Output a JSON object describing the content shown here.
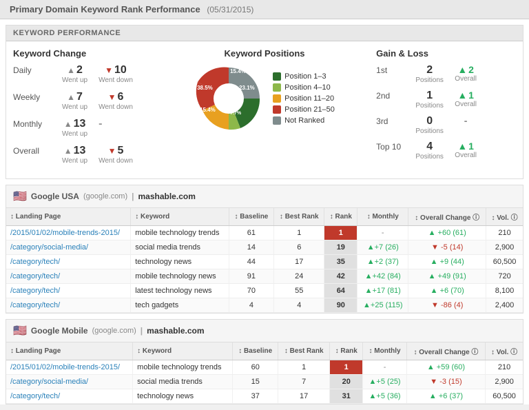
{
  "header": {
    "title": "Primary Domain Keyword Rank Performance",
    "date": "(05/31/2015)"
  },
  "keyword_performance": {
    "section_label": "KEYWORD PERFORMANCE",
    "keyword_change": {
      "title": "Keyword Change",
      "rows": [
        {
          "label": "Daily",
          "up": "2",
          "up_sub": "Went up",
          "down": "10",
          "down_sub": "Went down",
          "has_down": true
        },
        {
          "label": "Weekly",
          "up": "7",
          "up_sub": "Went up",
          "down": "6",
          "down_sub": "Went down",
          "has_down": true
        },
        {
          "label": "Monthly",
          "up": "13",
          "up_sub": "Went up",
          "down": "-",
          "down_sub": "",
          "has_down": false
        },
        {
          "label": "Overall",
          "up": "13",
          "up_sub": "Went up",
          "down": "5",
          "down_sub": "Went down",
          "has_down": true
        }
      ]
    },
    "keyword_positions": {
      "title": "Keyword Positions",
      "chart": {
        "segments": [
          {
            "label": "Position 1–3",
            "color": "#2c6e2c",
            "percent": 23.1,
            "start": 0
          },
          {
            "label": "Position 4–10",
            "color": "#8db84a",
            "percent": 7.7,
            "start": 23.1
          },
          {
            "label": "Position 11–20",
            "color": "#e8a020",
            "percent": 15.4,
            "start": 30.8
          },
          {
            "label": "Position 21–50",
            "color": "#c0392b",
            "percent": 38.5,
            "start": 46.2
          },
          {
            "label": "Not Ranked",
            "color": "#7f8c8d",
            "percent": 15.4,
            "start": 84.7
          }
        ],
        "labels": [
          "23.1%",
          "7.7%",
          "38.5%",
          "15.4%",
          "15.4%"
        ]
      }
    },
    "gain_loss": {
      "title": "Gain & Loss",
      "rows": [
        {
          "label": "1st",
          "positions": "2",
          "positions_sub": "Positions",
          "overall": "2",
          "overall_icon": "up",
          "overall_sub": "Overall"
        },
        {
          "label": "2nd",
          "positions": "1",
          "positions_sub": "Positions",
          "overall": "1",
          "overall_icon": "up",
          "overall_sub": "Overall"
        },
        {
          "label": "3rd",
          "positions": "0",
          "positions_sub": "Positions",
          "overall": "-",
          "overall_icon": "none",
          "overall_sub": ""
        },
        {
          "label": "Top 10",
          "positions": "4",
          "positions_sub": "Positions",
          "overall": "1",
          "overall_icon": "up",
          "overall_sub": "Overall"
        }
      ]
    }
  },
  "google_usa": {
    "engine": "Google USA",
    "domain_display": "google.com",
    "target": "mashable.com",
    "columns": [
      "↕ Landing Page",
      "↕ Keyword",
      "↕ Baseline",
      "↕ Best Rank",
      "↕ Rank",
      "↕ Monthly",
      "↕ Overall Change ⓘ",
      "↕ Vol. ⓘ"
    ],
    "rows": [
      {
        "landing": "/2015/01/02/mobile-trends-2015/",
        "keyword": "mobile technology trends",
        "baseline": "61",
        "best_rank": "1",
        "rank": "1",
        "monthly": "-",
        "overall": "+60 (61)",
        "overall_dir": "up",
        "vol": "210"
      },
      {
        "landing": "/category/social-media/",
        "keyword": "social media trends",
        "baseline": "14",
        "best_rank": "6",
        "rank": "19",
        "monthly": "+7 (26)",
        "monthly_dir": "up",
        "overall": "-5 (14)",
        "overall_dir": "down",
        "vol": "2,900"
      },
      {
        "landing": "/category/tech/",
        "keyword": "technology news",
        "baseline": "44",
        "best_rank": "17",
        "rank": "35",
        "monthly": "+2 (37)",
        "monthly_dir": "up",
        "overall": "+9 (44)",
        "overall_dir": "up",
        "vol": "60,500"
      },
      {
        "landing": "/category/tech/",
        "keyword": "mobile technology news",
        "baseline": "91",
        "best_rank": "24",
        "rank": "42",
        "monthly": "+42 (84)",
        "monthly_dir": "up",
        "overall": "+49 (91)",
        "overall_dir": "up",
        "vol": "720"
      },
      {
        "landing": "/category/tech/",
        "keyword": "latest technology news",
        "baseline": "70",
        "best_rank": "55",
        "rank": "64",
        "monthly": "+17 (81)",
        "monthly_dir": "up",
        "overall": "+6 (70)",
        "overall_dir": "up",
        "vol": "8,100"
      },
      {
        "landing": "/category/tech/",
        "keyword": "tech gadgets",
        "baseline": "4",
        "best_rank": "4",
        "rank": "90",
        "monthly": "+25 (115)",
        "monthly_dir": "up",
        "overall": "-86 (4)",
        "overall_dir": "down",
        "vol": "2,400"
      }
    ]
  },
  "google_mobile": {
    "engine": "Google Mobile",
    "domain_display": "google.com",
    "target": "mashable.com",
    "columns": [
      "↕ Landing Page",
      "↕ Keyword",
      "↕ Baseline",
      "↕ Best Rank",
      "↕ Rank",
      "↕ Monthly",
      "↕ Overall Change ⓘ",
      "↕ Vol. ⓘ"
    ],
    "rows": [
      {
        "landing": "/2015/01/02/mobile-trends-2015/",
        "keyword": "mobile technology trends",
        "baseline": "60",
        "best_rank": "1",
        "rank": "1",
        "monthly": "-",
        "overall": "+59 (60)",
        "overall_dir": "up",
        "vol": "210"
      },
      {
        "landing": "/category/social-media/",
        "keyword": "social media trends",
        "baseline": "15",
        "best_rank": "7",
        "rank": "20",
        "monthly": "+5 (25)",
        "monthly_dir": "up",
        "overall": "-3 (15)",
        "overall_dir": "down",
        "vol": "2,900"
      },
      {
        "landing": "/category/tech/",
        "keyword": "technology news",
        "baseline": "37",
        "best_rank": "17",
        "rank": "31",
        "monthly": "+5 (36)",
        "monthly_dir": "up",
        "overall": "+6 (37)",
        "overall_dir": "up",
        "vol": "60,500"
      }
    ]
  }
}
